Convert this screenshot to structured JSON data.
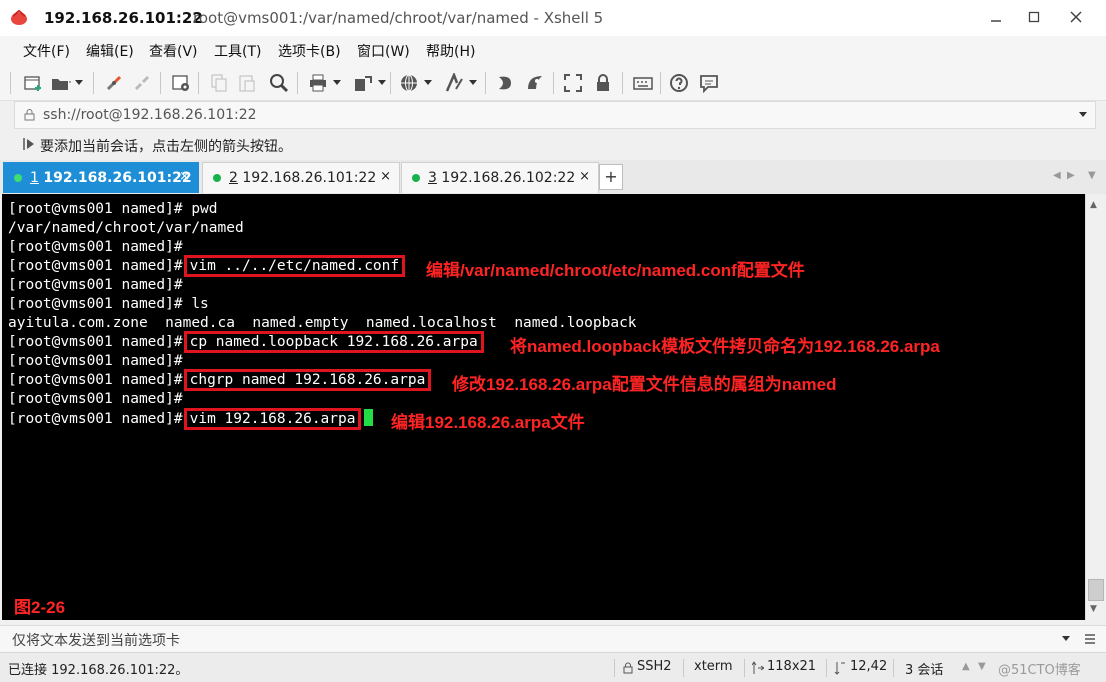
{
  "window": {
    "title_host": "192.168.26.101:22",
    "title_path": "root@vms001:/var/named/chroot/var/named - Xshell 5"
  },
  "menu": [
    "文件(F)",
    "编辑(E)",
    "查看(V)",
    "工具(T)",
    "选项卡(B)",
    "窗口(W)",
    "帮助(H)"
  ],
  "address": {
    "value": "ssh://root@192.168.26.101:22"
  },
  "hint": "要添加当前会话，点击左侧的箭头按钮。",
  "tabs": [
    {
      "num": "1",
      "label": "192.168.26.101:22",
      "active": true
    },
    {
      "num": "2",
      "label": "192.168.26.101:22",
      "active": false
    },
    {
      "num": "3",
      "label": "192.168.26.102:22",
      "active": false
    }
  ],
  "terminal": {
    "prompt": "[root@vms001 named]#",
    "lines": [
      {
        "text": "[root@vms001 named]# pwd"
      },
      {
        "text": "/var/named/chroot/var/named"
      },
      {
        "text": "[root@vms001 named]#"
      },
      {
        "cmd": "vim ../../etc/named.conf",
        "note": "编辑/var/named/chroot/etc/named.conf配置文件"
      },
      {
        "text": "[root@vms001 named]#"
      },
      {
        "text": "[root@vms001 named]# ls"
      },
      {
        "text": "ayitula.com.zone  named.ca  named.empty  named.localhost  named.loopback"
      },
      {
        "cmd": "cp named.loopback 192.168.26.arpa",
        "note": "将named.loopback模板文件拷贝命名为192.168.26.arpa"
      },
      {
        "text": "[root@vms001 named]#"
      },
      {
        "cmd": "chgrp named 192.168.26.arpa",
        "note": "修改192.168.26.arpa配置文件信息的属组为named"
      },
      {
        "text": "[root@vms001 named]#"
      },
      {
        "cmd": "vim 192.168.26.arpa",
        "note": "编辑192.168.26.arpa文件"
      }
    ],
    "figure_label": "图2-26"
  },
  "sendbar": {
    "placeholder": "仅将文本发送到当前选项卡"
  },
  "status": {
    "connection": "已连接 192.168.26.101:22。",
    "protocol": "SSH2",
    "term": "xterm",
    "size": "118x21",
    "cursor": "12,42",
    "sessions": "3 会话"
  },
  "watermark": "@51CTO博客"
}
